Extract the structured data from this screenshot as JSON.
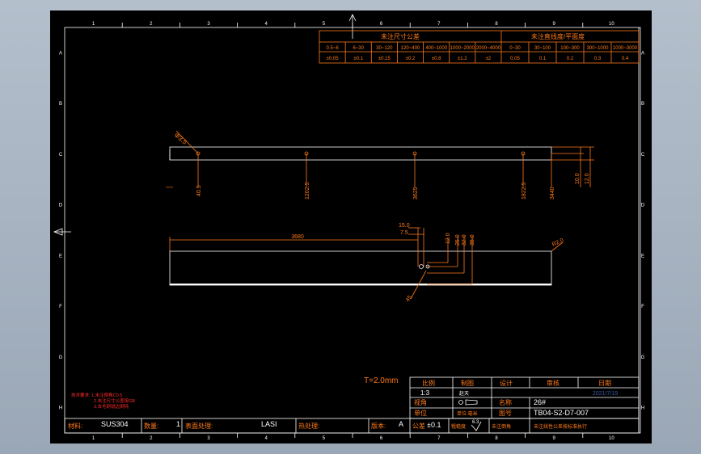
{
  "grid": {
    "col_labels": [
      "1",
      "2",
      "3",
      "4",
      "5",
      "6",
      "7",
      "8",
      "9",
      "10"
    ],
    "row_labels": [
      "A",
      "B",
      "C",
      "D",
      "E",
      "F",
      "G",
      "H"
    ]
  },
  "tolerance_table": {
    "linear_title": "未注尺寸公差",
    "angular_title": "未注直线度/平面度",
    "linear_ranges": [
      "0.5~6",
      "6~30",
      "30~120",
      "120~400",
      "400~1000",
      "1000~2000",
      "2000~4000"
    ],
    "linear_values": [
      "±0.05",
      "±0.1",
      "±0.15",
      "±0.2",
      "±0.8",
      "±1.2",
      "±2"
    ],
    "angular_ranges": [
      "0~30",
      "30~100",
      "100~300",
      "300~1000",
      "1000~3000"
    ],
    "angular_values": [
      "0.05",
      "0.1",
      "0.2",
      "0.3",
      "0.4"
    ]
  },
  "drawing": {
    "top_view": {
      "hole_label": "Φ3.5",
      "hole_positions": [
        "40.5",
        "1202.5",
        "3625",
        "1822.5",
        "3440"
      ],
      "height_dims": [
        "10.0",
        "12.0"
      ],
      "left_mark": "—"
    },
    "front_view": {
      "length": "3680",
      "dims": [
        "15.0",
        "7.5",
        "12.0",
        "25.0",
        "32.0",
        "35.0"
      ],
      "radius": "R2.0",
      "angle": "45"
    },
    "thickness": "T=2.0mm"
  },
  "title_block": {
    "headers": [
      "比例",
      "制图",
      "设计",
      "审核",
      "日期"
    ],
    "scale": "1:3",
    "drafter": "赵天",
    "date": "2021/7/19",
    "view_label": "视角",
    "name_label": "名称",
    "name_value": "26#",
    "drawing_no_label": "图号",
    "drawing_no": "TB04-S2-D7-007",
    "unit_label": "单位",
    "unit_value": "单位:毫米",
    "company": "未注线性公差按标准执行",
    "tolerance_label": "公差",
    "tolerance_value": "±0.1",
    "roughness_label": "粗糙度",
    "roughness_value": "6.3",
    "note_label": "未注倒角",
    "material_label": "材料:",
    "material": "SUS304",
    "qty_label": "数量:",
    "qty": "1",
    "surface_label": "表面处理:",
    "surface": "LASI",
    "heat_label": "热处理:",
    "heat": "",
    "version_label": "版本:",
    "version": "A"
  },
  "notes": {
    "line1": "技术要求: 1.未注倒角C0.5",
    "line2": "2.未注尺寸公差按GB",
    "line3": "3.去毛刺锐边倒钝"
  },
  "colors": {
    "background": "#000000",
    "frame": "#ffffff",
    "dimension": "#ff7a1a",
    "notes": "#ff2a2a"
  }
}
